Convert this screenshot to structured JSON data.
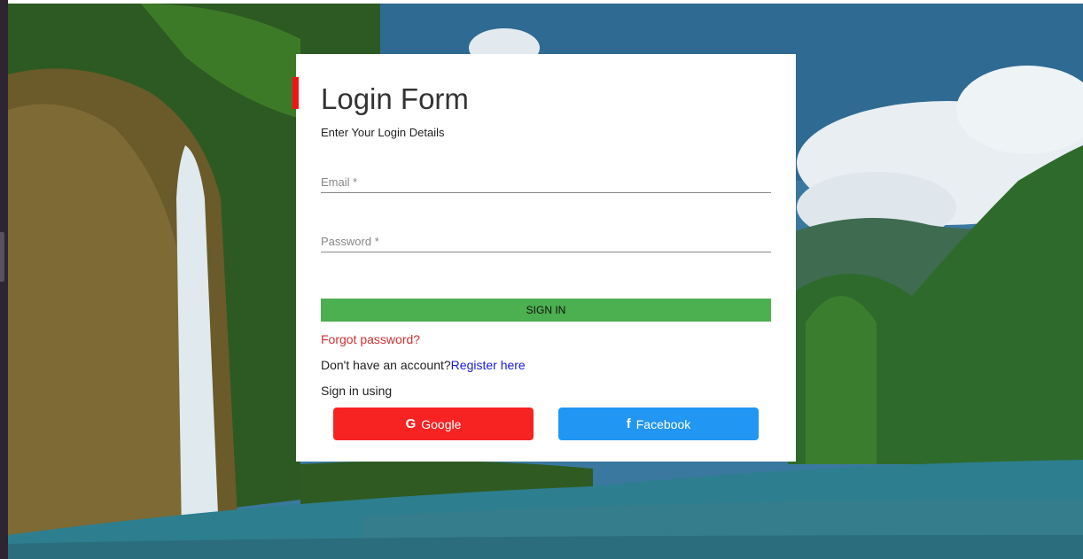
{
  "form": {
    "title": "Login Form",
    "subtitle": "Enter Your Login Details",
    "email_placeholder": "Email *",
    "password_placeholder": "Password *",
    "sign_in_label": "SIGN IN",
    "forgot_label": "Forgot password?",
    "no_account_text": "Don't have an account?",
    "register_label": "Register here",
    "sign_in_using": "Sign in using",
    "google_label": "Google",
    "facebook_label": "Facebook",
    "google_icon_glyph": "G",
    "facebook_icon_glyph": "f"
  },
  "colors": {
    "accent": "#f01414",
    "sign_in_bg": "#4caf50",
    "google_bg": "#f72323",
    "facebook_bg": "#2196f3",
    "link": "#1a1adc",
    "forgot": "#d32f2f"
  },
  "icons": {
    "google": "google-icon",
    "facebook": "facebook-icon"
  }
}
